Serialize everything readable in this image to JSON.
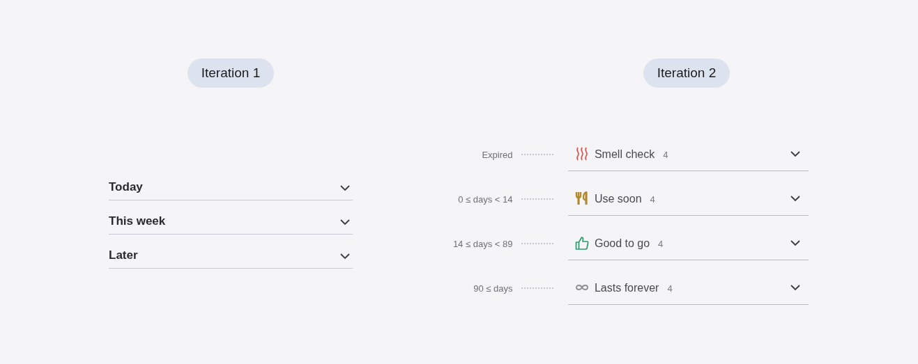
{
  "iteration_1": {
    "title": "Iteration 1",
    "sections": [
      {
        "label": "Today",
        "expanded": false
      },
      {
        "label": "This week",
        "expanded": false
      },
      {
        "label": "Later",
        "expanded": false
      }
    ]
  },
  "iteration_2": {
    "title": "Iteration 2",
    "buckets": [
      {
        "range": "Expired",
        "kind": "waves",
        "color": "#d9534f",
        "label": "Smell check",
        "count": "4",
        "expanded": false
      },
      {
        "range": "0 ≤ days < 14",
        "kind": "utensils",
        "color": "#b08a2e",
        "label": "Use soon",
        "count": "4",
        "expanded": false
      },
      {
        "range": "14 ≤ days < 89",
        "kind": "thumbs-up",
        "color": "#2e9a6e",
        "label": "Good to go",
        "count": "4",
        "expanded": false
      },
      {
        "range": "90 ≤  days",
        "kind": "infinity",
        "color": "#8e8e93",
        "label": "Lasts forever",
        "count": "4",
        "expanded": false
      }
    ]
  }
}
